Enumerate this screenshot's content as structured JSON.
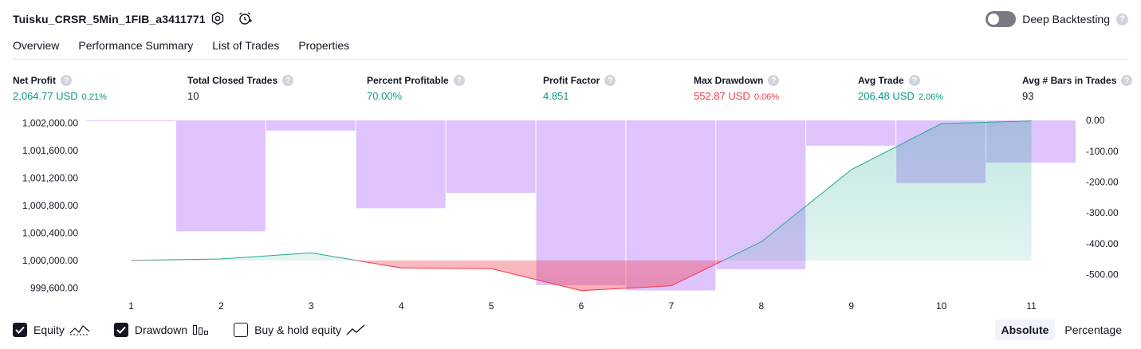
{
  "header": {
    "strategy_title": "Tuisku_CRSR_5Min_1FIB_a3411771",
    "deep_backtesting_label": "Deep Backtesting",
    "help_glyph": "?"
  },
  "tabs": [
    {
      "label": "Overview",
      "active": true
    },
    {
      "label": "Performance Summary",
      "active": false
    },
    {
      "label": "List of Trades",
      "active": false
    },
    {
      "label": "Properties",
      "active": false
    }
  ],
  "metrics": {
    "net_profit": {
      "label": "Net Profit",
      "value": "2,064.77 USD",
      "pct": "0.21%"
    },
    "total_closed_trades": {
      "label": "Total Closed Trades",
      "value": "10"
    },
    "percent_profitable": {
      "label": "Percent Profitable",
      "value": "70.00%"
    },
    "profit_factor": {
      "label": "Profit Factor",
      "value": "4.851"
    },
    "max_drawdown": {
      "label": "Max Drawdown",
      "value": "552.87 USD",
      "pct": "0.06%"
    },
    "avg_trade": {
      "label": "Avg Trade",
      "value": "206.48 USD",
      "pct": "2.06%"
    },
    "avg_bars": {
      "label": "Avg # Bars in Trades",
      "value": "93"
    }
  },
  "chart_data": {
    "type": "line",
    "x": [
      1,
      2,
      3,
      4,
      5,
      6,
      7,
      8,
      9,
      10,
      11
    ],
    "left_axis_ticks": [
      "1,002,000.00",
      "1,001,600.00",
      "1,001,200.00",
      "1,000,800.00",
      "1,000,400.00",
      "1,000,000.00",
      "999,600.00"
    ],
    "right_axis_ticks": [
      "0.00",
      "-100.00",
      "-200.00",
      "-300.00",
      "-400.00",
      "-500.00"
    ],
    "left_ylim": [
      999580,
      1002050
    ],
    "right_ylim": [
      -548,
      3
    ],
    "equity_baseline": 1000000,
    "series": [
      {
        "name": "Equity",
        "axis": "left",
        "values": [
          1000000,
          1000020,
          1000110,
          999890,
          999880,
          999560,
          999630,
          1000270,
          1001320,
          1001990,
          1002030
        ]
      },
      {
        "name": "Drawdown",
        "axis": "right",
        "values": [
          0,
          -360,
          -33,
          -285,
          -235,
          -535,
          -552,
          -483,
          -82,
          -203,
          -137
        ]
      }
    ],
    "colors": {
      "equity_up": "#22ab94",
      "equity_down": "#f23645",
      "drawdown": "#d9b8fd"
    }
  },
  "legend": [
    {
      "label": "Equity",
      "checked": true,
      "icon": "equity-line-icon"
    },
    {
      "label": "Drawdown",
      "checked": true,
      "icon": "drawdown-bars-icon"
    },
    {
      "label": "Buy & hold equity",
      "checked": false,
      "icon": "buy-hold-line-icon"
    }
  ],
  "modes": [
    {
      "label": "Absolute",
      "active": true
    },
    {
      "label": "Percentage",
      "active": false
    }
  ]
}
